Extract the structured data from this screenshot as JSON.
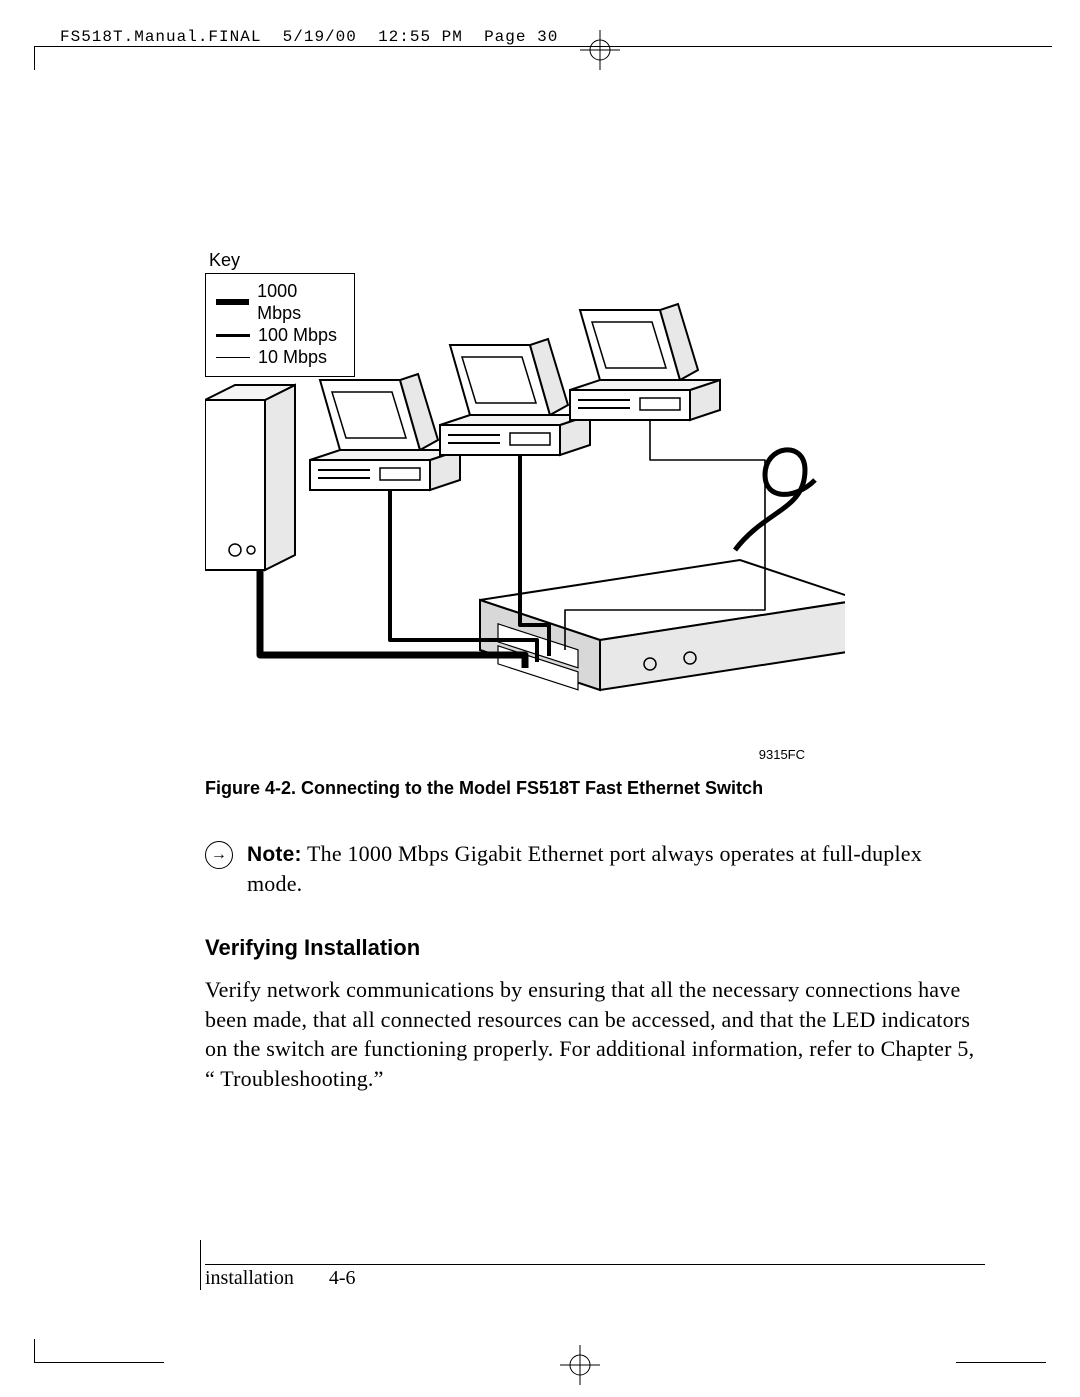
{
  "header": {
    "slug": "FS518T.Manual.FINAL",
    "date": "5/19/00",
    "time": "12:55 PM",
    "page_label": "Page 30"
  },
  "legend": {
    "title": "Key",
    "items": [
      {
        "label": "1000 Mbps",
        "weight": "thick"
      },
      {
        "label": "100 Mbps",
        "weight": "med"
      },
      {
        "label": "10 Mbps",
        "weight": "thin"
      }
    ]
  },
  "figure": {
    "code": "9315FC",
    "caption": "Figure 4-2.  Connecting to the Model FS518T Fast Ethernet Switch"
  },
  "note": {
    "label": "Note:",
    "text": "The 1000 Mbps Gigabit Ethernet port always operates at full-duplex mode."
  },
  "section": {
    "heading": "Verifying Installation",
    "para": "Verify network communications by ensuring that all the necessary connections have been made, that all connected resources can be accessed, and that the LED indicators on the switch are functioning properly. For additional information, refer to Chapter 5, “ Troubleshooting.”"
  },
  "footer": {
    "section": "installation",
    "page": "4-6"
  }
}
